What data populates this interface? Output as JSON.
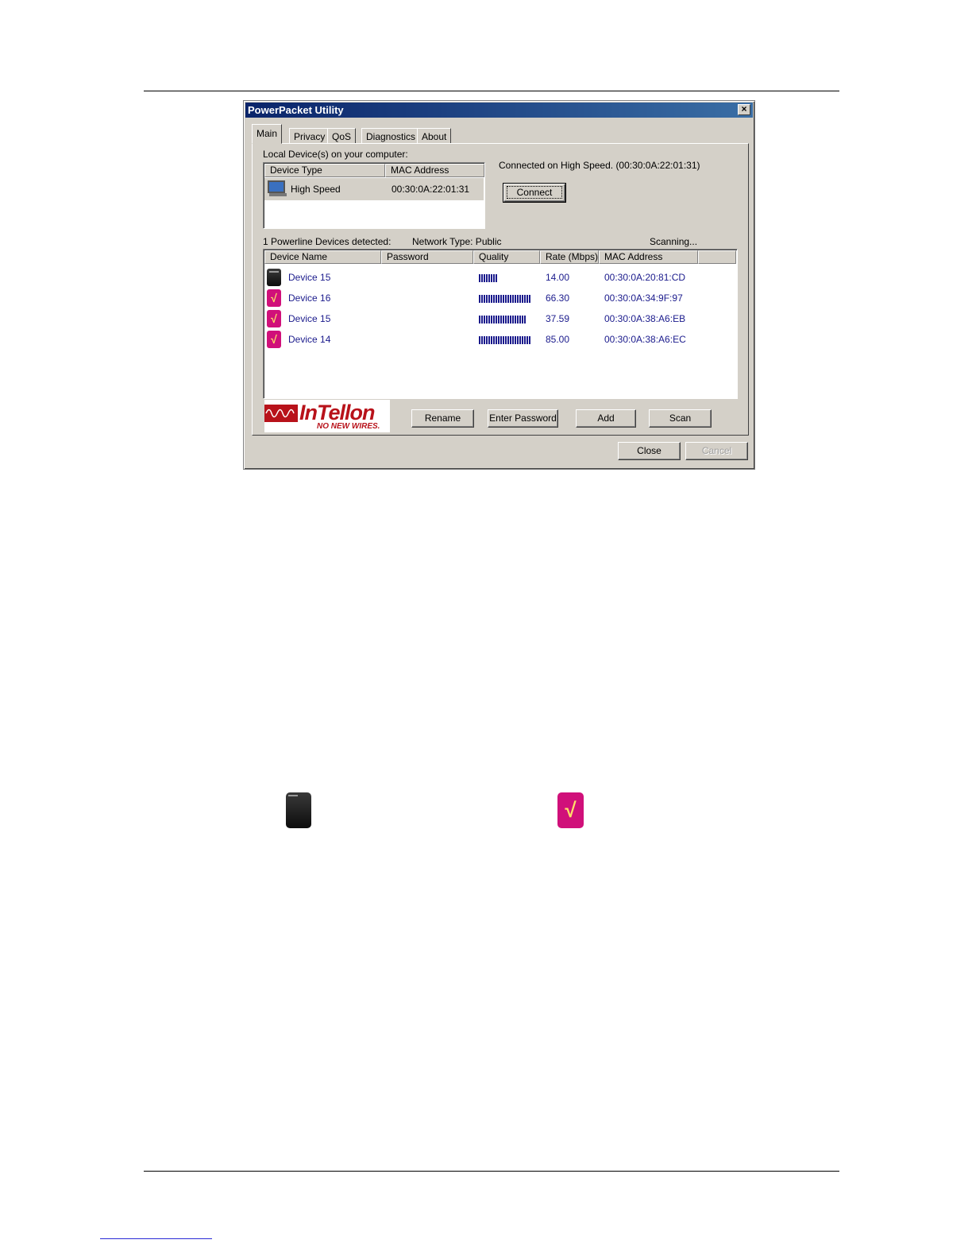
{
  "window": {
    "title": "PowerPacket Utility",
    "close_glyph": "×"
  },
  "tabs": [
    "Main",
    "Privacy",
    "QoS",
    "Diagnostics",
    "About"
  ],
  "local": {
    "heading": "Local Device(s) on your computer:",
    "columns": [
      "Device Type",
      "MAC Address"
    ],
    "device_type": "High Speed",
    "mac": "00:30:0A:22:01:31",
    "icon": "computer-icon",
    "status": "Connected on  High Speed. (00:30:0A:22:01:31)",
    "connect_label": "Connect"
  },
  "powerline": {
    "detected": "1 Powerline Devices detected:",
    "network_type": "Network Type: Public",
    "scanning": "Scanning...",
    "columns": [
      "Device Name",
      "Password",
      "Quality",
      "Rate (Mbps)",
      "MAC Address"
    ],
    "rows": [
      {
        "name": "Device 15",
        "quality": 0.35,
        "rate": "14.00",
        "mac": "00:30:0A:20:81:CD",
        "icon": "black-adapter-icon"
      },
      {
        "name": "Device 16",
        "quality": 1.0,
        "rate": "66.30",
        "mac": "00:30:0A:34:9F:97",
        "icon": "pink-adapter-icon"
      },
      {
        "name": "Device 15",
        "quality": 0.9,
        "rate": "37.59",
        "mac": "00:30:0A:38:A6:EB",
        "icon": "pink-adapter-icon"
      },
      {
        "name": "Device 14",
        "quality": 1.0,
        "rate": "85.00",
        "mac": "00:30:0A:38:A6:EC",
        "icon": "pink-adapter-icon"
      }
    ]
  },
  "logo": {
    "name": "InTellon",
    "tagline": "NO NEW WIRES."
  },
  "buttons": {
    "rename": "Rename",
    "enter_password": "Enter Password",
    "add": "Add",
    "scan": "Scan",
    "close": "Close",
    "cancel": "Cancel"
  },
  "colors": {
    "link_text": "#1a1a8c",
    "title_bar": "#0a246a",
    "pink_device": "#d0107a",
    "logo_red": "#b8121a"
  }
}
